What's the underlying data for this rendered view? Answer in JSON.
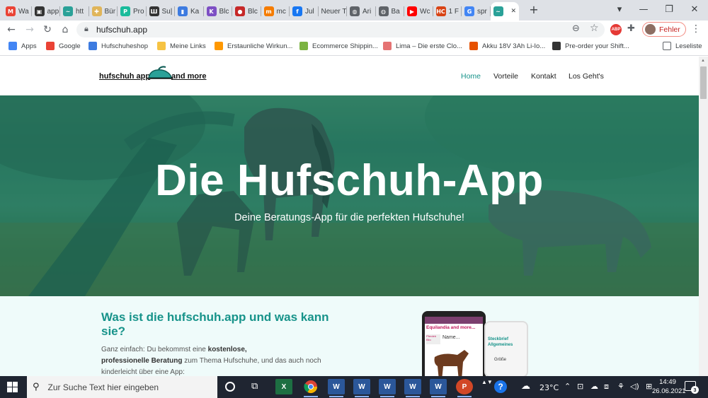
{
  "browser": {
    "tabs": [
      {
        "label": "Wa",
        "icon": "gmail-icon",
        "color": "#ea4335",
        "glyph": "M"
      },
      {
        "label": "app",
        "icon": "app-store-icon",
        "color": "#333333",
        "glyph": "▣"
      },
      {
        "label": "htt",
        "icon": "horse-logo-icon",
        "color": "#2aa198",
        "glyph": "~"
      },
      {
        "label": "Bür",
        "icon": "puzzle-favicon-icon",
        "color": "#e0b55a",
        "glyph": "✚"
      },
      {
        "label": "Pro",
        "icon": "green-circle-icon",
        "color": "#1abc9c",
        "glyph": "P"
      },
      {
        "label": "Su|",
        "icon": "book-icon",
        "color": "#333333",
        "glyph": "Ш"
      },
      {
        "label": "Ka",
        "icon": "shopping-bag-icon",
        "color": "#3d7be0",
        "glyph": "▮"
      },
      {
        "label": "Blc",
        "icon": "k-logo-icon",
        "color": "#7d4fc4",
        "glyph": "K"
      },
      {
        "label": "Blc",
        "icon": "red-swirl-icon",
        "color": "#c62828",
        "glyph": "●"
      },
      {
        "label": "mc",
        "icon": "m-logo-icon",
        "color": "#f57c00",
        "glyph": "m"
      },
      {
        "label": "Jul",
        "icon": "facebook-icon",
        "color": "#1877f2",
        "glyph": "f"
      },
      {
        "label": "Neuer T",
        "icon": "",
        "color": "",
        "glyph": ""
      },
      {
        "label": "Ari",
        "icon": "globe-icon",
        "color": "#5f6368",
        "glyph": "◍"
      },
      {
        "label": "Ba",
        "icon": "globe-icon",
        "color": "#5f6368",
        "glyph": "◍"
      },
      {
        "label": "Wc",
        "icon": "youtube-icon",
        "color": "#ff0000",
        "glyph": "▶"
      },
      {
        "label": "1 F",
        "icon": "hc-logo-icon",
        "color": "#d84315",
        "glyph": "HC"
      },
      {
        "label": "spr",
        "icon": "google-icon",
        "color": "#4285f4",
        "glyph": "G"
      },
      {
        "label": "",
        "icon": "horse-logo-icon",
        "color": "#2aa198",
        "glyph": "~"
      }
    ],
    "new_tab": "+",
    "url": "hufschuh.app",
    "profile_label": "Fehler",
    "bookmarks": [
      {
        "label": "Apps",
        "icon": "apps-grid-icon",
        "color": "#4285f4"
      },
      {
        "label": "Google",
        "icon": "google-icon",
        "color": "#ea4335"
      },
      {
        "label": "Hufschuheshop",
        "icon": "shop-icon",
        "color": "#3d7be0"
      },
      {
        "label": "Meine Links",
        "icon": "folder-icon",
        "color": "#f6c343"
      },
      {
        "label": "Erstaunliche Wirkun...",
        "icon": "sun-icon",
        "color": "#ff9800"
      },
      {
        "label": "Ecommerce Shippin...",
        "icon": "gear-icon",
        "color": "#7cb342"
      },
      {
        "label": "Lima – Die erste Clo...",
        "icon": "cloud-icon",
        "color": "#e57373"
      },
      {
        "label": "Akku 18V 3Ah Li-Io...",
        "icon": "battery-icon",
        "color": "#e65100"
      },
      {
        "label": "Pre-order your Shift...",
        "icon": "arrow-icon",
        "color": "#333333"
      }
    ],
    "reading_list": "Leseliste"
  },
  "site": {
    "logo_left": "hufschuh app",
    "logo_right": "and more",
    "nav": [
      "Home",
      "Vorteile",
      "Kontakt",
      "Los Geht's"
    ],
    "hero_title": "Die Hufschuh-App",
    "hero_subtitle": "Deine Beratungs-App für die perfekten Hufschuhe!",
    "about_title": "Was ist die hufschuh.app und was kann sie?",
    "about_text_1": "Ganz einfach: Du bekommst eine ",
    "about_text_bold_1": "kostenlose,",
    "about_text_bold_2": "professionelle Beratung",
    "about_text_2": " zum Thema Hufschuhe, und das auch noch",
    "about_text_3": "kinderleicht über eine App:",
    "phone1_header": "Equilandia and more...",
    "phone1_field": "Name...",
    "phone1_badge": "Pferdeb Bilo",
    "phone2_header": "Steckbrief Allgemeines",
    "phone2_field": "Größe",
    "accent_color": "#17938a"
  },
  "taskbar": {
    "search_placeholder": "Zur Suche Text hier eingeben",
    "weather": "23°C",
    "time": "14:49",
    "date": "26.06.2021",
    "notification_count": "3"
  }
}
